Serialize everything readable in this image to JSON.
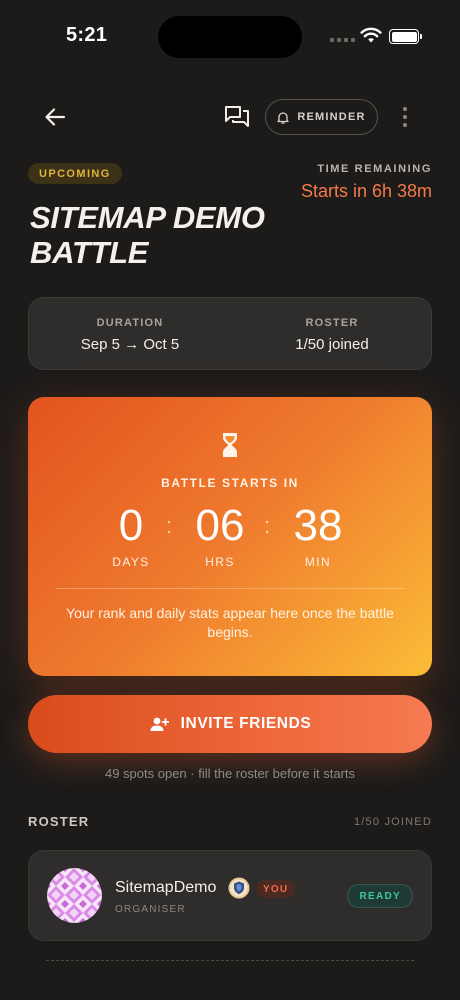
{
  "status_bar": {
    "time": "5:21"
  },
  "header": {
    "reminder_label": "REMINDER"
  },
  "battle": {
    "status_badge": "UPCOMING",
    "time_remaining_label": "TIME REMAINING",
    "time_remaining_value": "Starts in 6h 38m",
    "title": "SITEMAP DEMO BATTLE"
  },
  "info": {
    "duration_label": "DURATION",
    "duration_value": "Sep 5 → Oct 5",
    "roster_label": "ROSTER",
    "roster_value": "1/50 joined"
  },
  "countdown": {
    "label": "BATTLE STARTS IN",
    "days": "0",
    "days_label": "DAYS",
    "hrs": "06",
    "hrs_label": "HRS",
    "min": "38",
    "min_label": "MIN",
    "separator": ":",
    "note": "Your rank and daily stats appear here once the battle begins."
  },
  "invite": {
    "button_label": "INVITE FRIENDS",
    "note": "49 spots open · fill the roster before it starts"
  },
  "roster": {
    "title": "ROSTER",
    "count": "1/50 JOINED",
    "members": [
      {
        "name": "SitemapDemo",
        "you_badge": "YOU",
        "role": "ORGANISER",
        "status": "READY"
      }
    ]
  },
  "colors": {
    "accent": "#f47a46",
    "upcoming": "#e0b23c",
    "ready": "#3ec6a6",
    "background": "#1c1b1a"
  },
  "icons": [
    "back-arrow-icon",
    "chat-icon",
    "bell-icon",
    "more-vertical-icon",
    "hourglass-icon",
    "add-person-icon",
    "shield-icon"
  ]
}
